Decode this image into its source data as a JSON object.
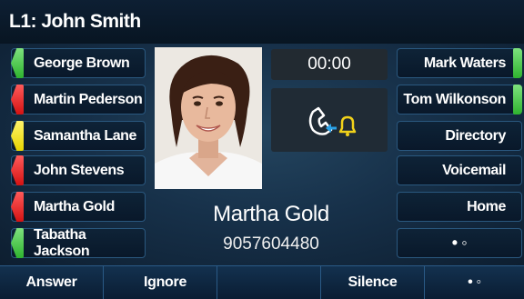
{
  "header": {
    "title": "L1: John Smith"
  },
  "line_keys_left": [
    {
      "label": "George Brown",
      "led": "green"
    },
    {
      "label": "Martin Pederson",
      "led": "red"
    },
    {
      "label": "Samantha Lane",
      "led": "yellow"
    },
    {
      "label": "John Stevens",
      "led": "red"
    },
    {
      "label": "Martha Gold",
      "led": "red"
    },
    {
      "label": "Tabatha Jackson",
      "led": "green"
    }
  ],
  "line_keys_right": [
    {
      "label": "Mark Waters",
      "led": "green"
    },
    {
      "label": "Tom Wilkonson",
      "led": "green"
    },
    {
      "label": "Directory"
    },
    {
      "label": "Voicemail"
    },
    {
      "label": "Home"
    },
    {
      "label": "• ◦"
    }
  ],
  "call": {
    "timer": "00:00",
    "state_icon": "incoming-call-icon",
    "caller_name": "Martha Gold",
    "caller_number": "9057604480"
  },
  "softkeys": [
    {
      "label": "Answer"
    },
    {
      "label": "Ignore"
    },
    {
      "label": ""
    },
    {
      "label": "Silence"
    },
    {
      "label": "• ◦"
    }
  ],
  "colors": {
    "led_green": "#2fb32f",
    "led_red": "#d41313",
    "led_yellow": "#e6d400",
    "key_border": "#2a587f"
  }
}
